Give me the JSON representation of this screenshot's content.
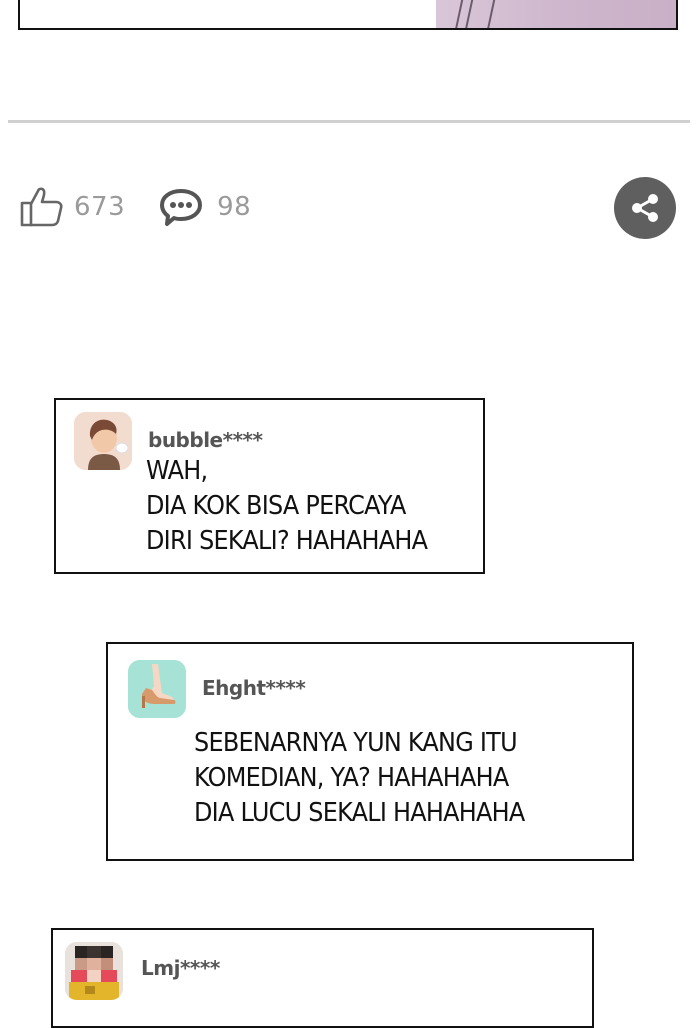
{
  "reactions": {
    "likes": "673",
    "comments": "98"
  },
  "icons": {
    "like": "thumbs-up-icon",
    "comment": "speech-bubble-icon",
    "share": "share-icon"
  },
  "colors": {
    "share_button_bg": "#5f5f5f",
    "counter_text": "#9a9a9a",
    "panel_lilac": "#cdb5cc"
  },
  "comments": [
    {
      "username": "bubble****",
      "avatar": "boy-profile-avatar",
      "text": "WAH,\nDIA KOK BISA PERCAYA\nDIRI SEKALI?  HAHAHAHA"
    },
    {
      "username": "Ehght****",
      "avatar": "high-heel-avatar",
      "text": "SEBENARNYA YUN KANG ITU\nKOMEDIAN, YA?  HAHAHAHA\nDIA LUCU SEKALI HAHAHAHA"
    },
    {
      "username": "Lmj****",
      "avatar": "pixelated-person-avatar",
      "text": ""
    }
  ]
}
